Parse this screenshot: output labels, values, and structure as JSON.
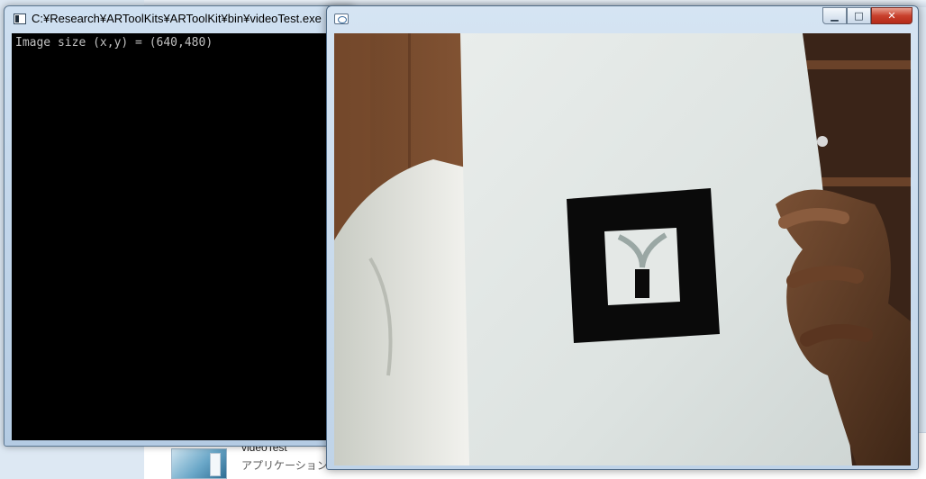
{
  "console": {
    "title": "C:¥Research¥ARToolKits¥ARToolKit¥bin¥videoTest.exe",
    "output": "Image size (x,y) = (640,480)"
  },
  "camera_window": {
    "title": "",
    "buttons": {
      "minimize": "▁",
      "maximize": "□",
      "close": "✕"
    },
    "frame_size": "640x480"
  },
  "background_explorer": {
    "file_name": "videoTest",
    "file_type": "アプリケーション"
  },
  "colors": {
    "console_bg": "#000000",
    "console_text": "#c0c0c0",
    "titlebar": "#c4d7ea",
    "close_button": "#c8402c",
    "marker_black": "#0a0a0a",
    "paper": "#dfe4e2",
    "wall_wood": "#8a5a3a"
  },
  "icons": [
    "console-app-icon",
    "camera-app-icon",
    "minimize-icon",
    "maximize-icon",
    "close-icon"
  ]
}
